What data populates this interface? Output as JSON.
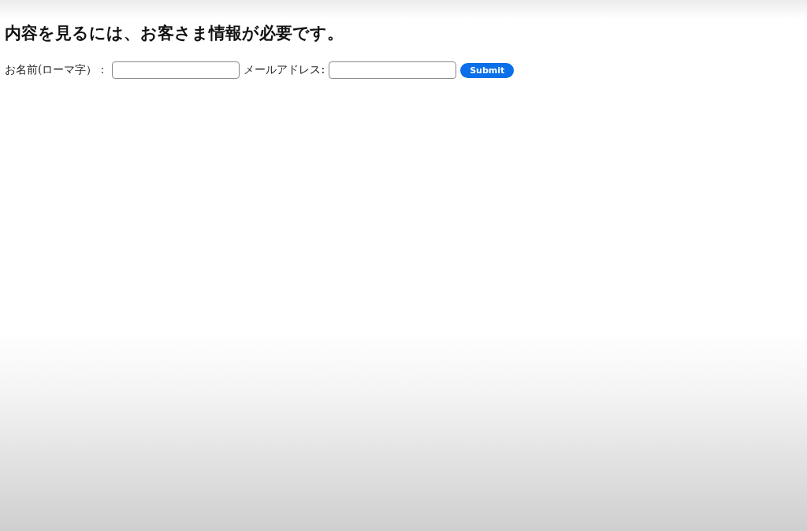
{
  "heading": "内容を見るには、お客さま情報が必要です。",
  "form": {
    "fields": [
      {
        "label": "お名前(ローマ字）："
      },
      {
        "label": "メールアドレス:"
      }
    ],
    "submit": "Submit"
  }
}
